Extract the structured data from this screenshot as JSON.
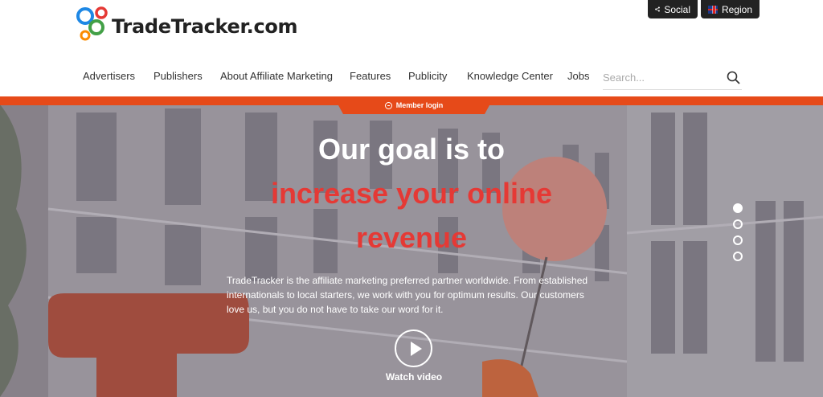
{
  "header": {
    "logo_text": "TradeTracker.com",
    "social_label": "Social",
    "region_label": "Region"
  },
  "nav": {
    "items": [
      "Advertisers",
      "Publishers",
      "About Affiliate Marketing",
      "Features",
      "Publicity",
      "Knowledge Center",
      "Jobs"
    ],
    "search_placeholder": "Search..."
  },
  "hero": {
    "member_login": "Member login",
    "headline_line1": "Our goal is to",
    "headline_line2": "increase your online",
    "headline_line3": "revenue",
    "description": "TradeTracker is the affiliate marketing preferred partner worldwide. From established internationals to local starters, we work with you for optimum results. Our customers love us, but you do not have to take our word for it.",
    "watch_video": "Watch video",
    "slides_count": 4,
    "active_slide": 1
  },
  "colors": {
    "accent": "#e64a19",
    "headline_red": "#e53935",
    "dark_button": "#222222"
  }
}
